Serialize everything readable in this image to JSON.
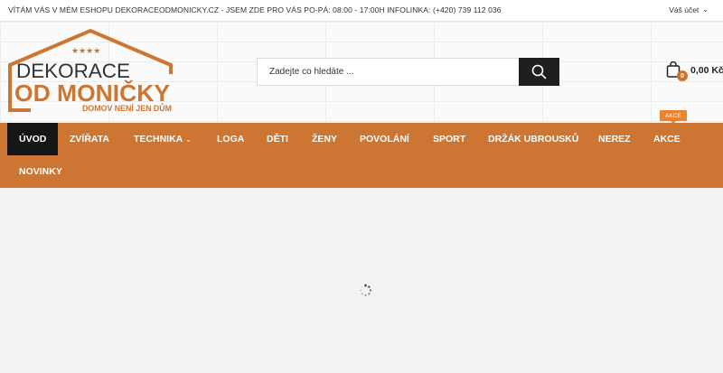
{
  "topbar": {
    "message": "VÍTÁM VÁS V MÉM ESHOPU DEKORACEODMONICKY.CZ - JSEM ZDE PRO VÁS PO-PÁ: 08:00 - 17:00H  INFOLINKA: (+420) 739 112 036",
    "account_label": "Váš účet"
  },
  "logo": {
    "line1": "DEKORACE",
    "line2": "OD MONIČKY",
    "tagline": "DOMOV NENÍ JEN DŮM",
    "stars": "★★★★"
  },
  "search": {
    "placeholder": "Zadejte co hledáte ...",
    "value": ""
  },
  "cart": {
    "count": "0",
    "total": "0,00 Kč"
  },
  "nav": {
    "items": [
      {
        "label": "ÚVOD",
        "active": true
      },
      {
        "label": "ZVÍŘATA"
      },
      {
        "label": "TECHNIKA",
        "dropdown": true
      },
      {
        "label": "LOGA"
      },
      {
        "label": "DĚTI"
      },
      {
        "label": "ŽENY"
      },
      {
        "label": "POVOLÁNÍ"
      },
      {
        "label": "SPORT"
      },
      {
        "label": "DRŽÁK UBROUSKŮ"
      },
      {
        "label": "NEREZ"
      },
      {
        "label": "AKCE"
      },
      {
        "label": "NOVINKY"
      }
    ],
    "badge": "AKCE"
  },
  "colors": {
    "brand": "#cd7532",
    "dark": "#151515",
    "badge": "#e8832e"
  },
  "icons": {
    "search": "search-icon",
    "cart": "shopping-bag-icon",
    "loading": "loading-spinner-icon"
  }
}
